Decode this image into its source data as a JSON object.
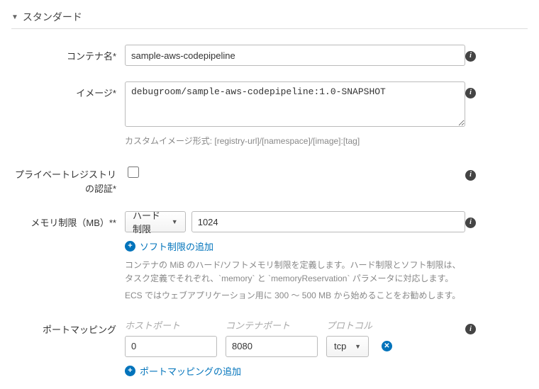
{
  "section": {
    "title": "スタンダード"
  },
  "container_name": {
    "label": "コンテナ名*",
    "value": "sample-aws-codepipeline"
  },
  "image": {
    "label": "イメージ*",
    "value": "debugroom/sample-aws-codepipeline:1.0-SNAPSHOT",
    "help": "カスタムイメージ形式: [registry-url]/[namespace]/[image]:[tag]"
  },
  "private_registry": {
    "label": "プライベートレジストリの認証*",
    "checked": false
  },
  "memory": {
    "label": "メモリ制限（MB）**",
    "limit_type": "ハード制限",
    "value": "1024",
    "add_soft": "ソフト制限の追加",
    "help1": "コンテナの MiB のハード/ソフトメモリ制限を定義します。ハード制限とソフト制限は、タスク定義でそれぞれ、`memory` と `memoryReservation` パラメータに対応します。",
    "help2": "ECS ではウェブアプリケーション用に 300 〜 500 MB から始めることをお勧めします。"
  },
  "port_mapping": {
    "label": "ポートマッピング",
    "headers": {
      "host": "ホストポート",
      "container": "コンテナポート",
      "protocol": "プロトコル"
    },
    "rows": [
      {
        "host": "0",
        "container": "8080",
        "protocol": "tcp"
      }
    ],
    "add": "ポートマッピングの追加"
  }
}
